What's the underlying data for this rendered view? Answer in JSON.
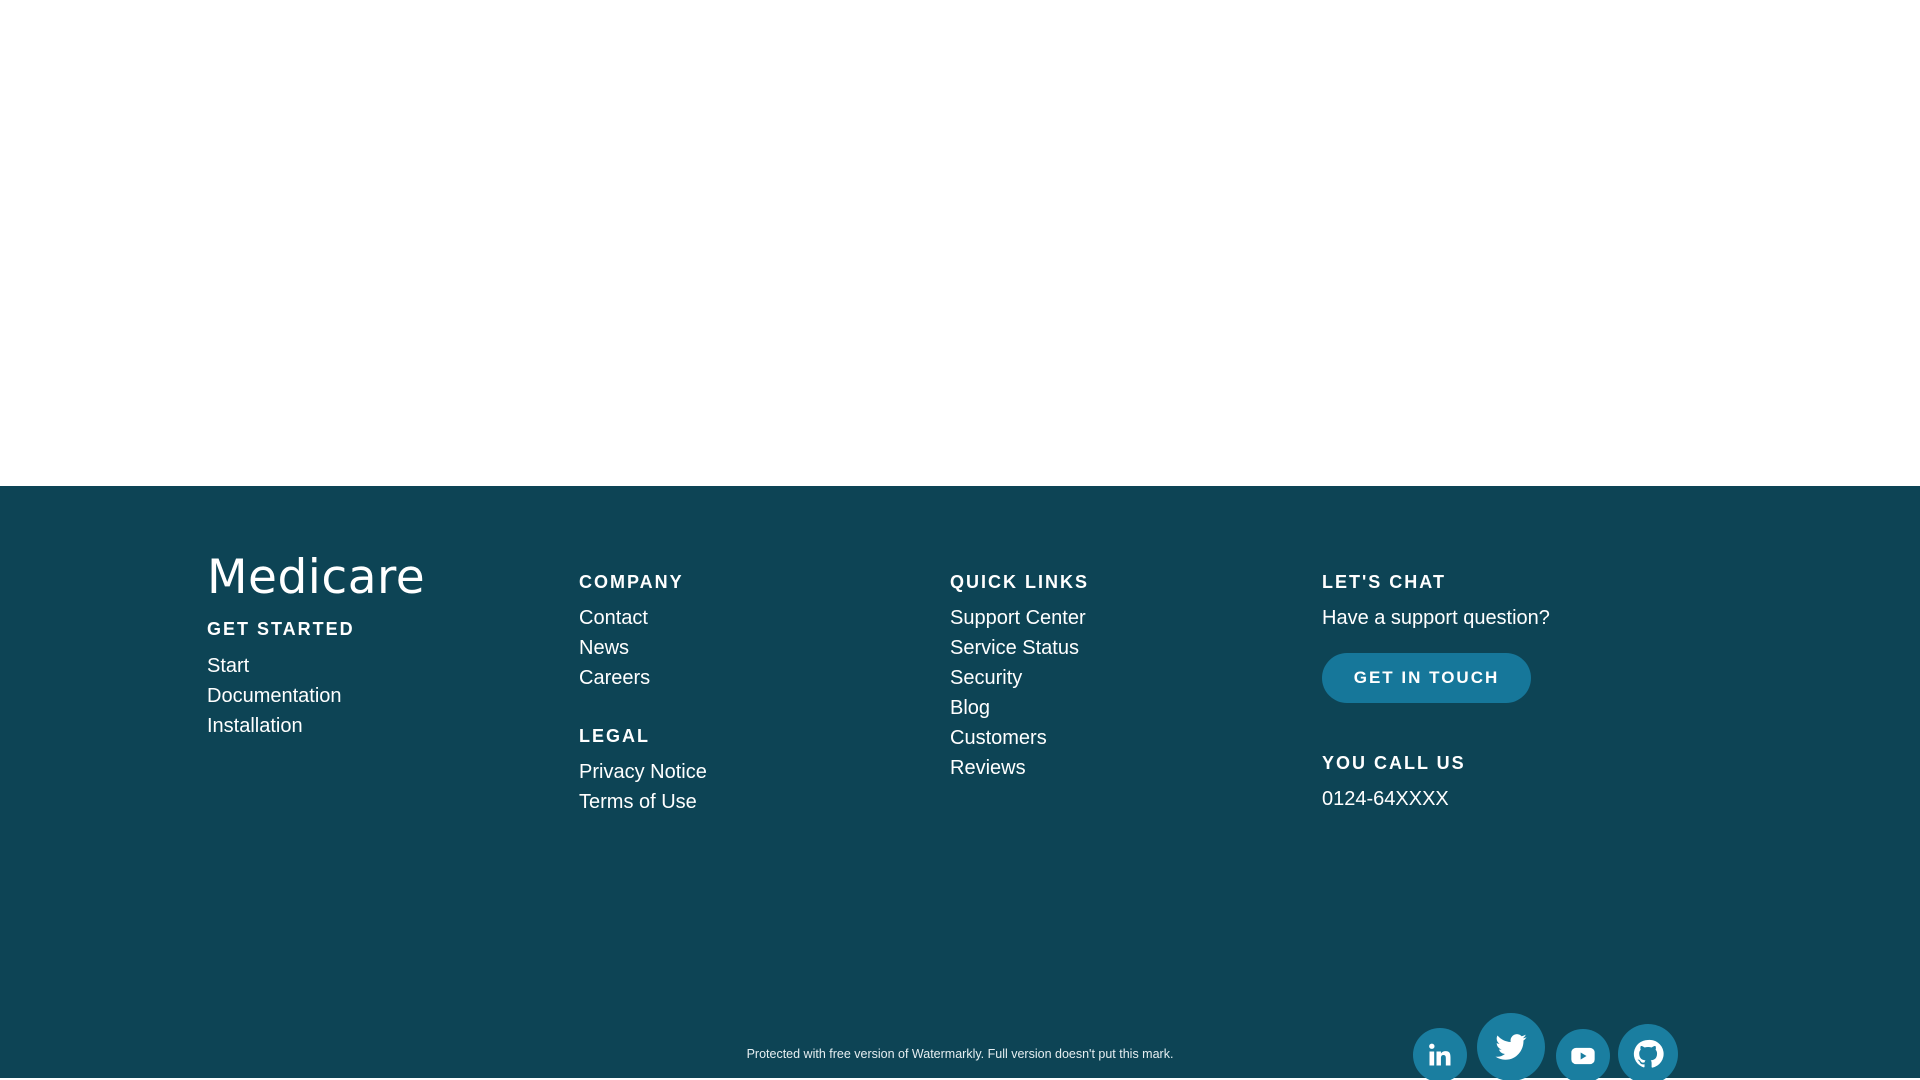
{
  "brand": {
    "name": "Medicare"
  },
  "colors": {
    "footer_bg": "#0d4455",
    "accent": "#16779a",
    "social_bg": "#1a7ea0",
    "text": "#ffffff"
  },
  "get_started": {
    "heading": "GET STARTED",
    "links": [
      "Start",
      "Documentation",
      "Installation"
    ]
  },
  "company": {
    "heading": "COMPANY",
    "links": [
      "Contact",
      "News",
      "Careers"
    ]
  },
  "legal": {
    "heading": "LEGAL",
    "links": [
      "Privacy Notice",
      "Terms of Use"
    ]
  },
  "quick_links": {
    "heading": "QUICK LINKS",
    "links": [
      "Support Center",
      "Service Status",
      "Security",
      "Blog",
      "Customers",
      "Reviews"
    ]
  },
  "chat": {
    "heading": "LET'S CHAT",
    "question": "Have a support question?",
    "button_label": "GET IN TOUCH"
  },
  "call": {
    "heading": "YOU CALL US",
    "phone": "0124-64XXXX"
  },
  "watermark": "Protected with free version of Watermarkly. Full version doesn't put this mark.",
  "social": [
    {
      "icon": "linkedin-icon"
    },
    {
      "icon": "twitter-icon"
    },
    {
      "icon": "youtube-icon"
    },
    {
      "icon": "github-icon"
    }
  ]
}
